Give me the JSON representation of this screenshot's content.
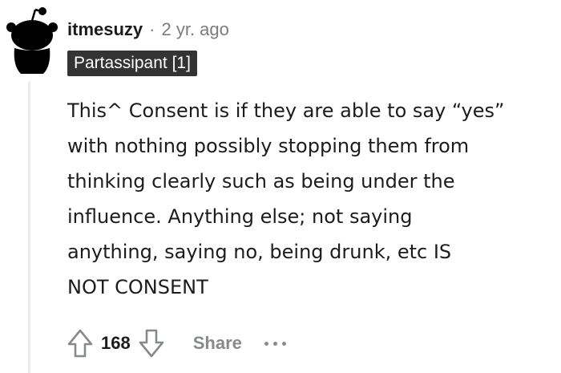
{
  "comment": {
    "username": "itmesuzy",
    "separator": "·",
    "timestamp": "2 yr. ago",
    "flair": "Partassipant [1]",
    "avatar_icon": "snoo-avatar-icon",
    "body_lines": [
      "This^ Consent is if they are able to say “yes”",
      "with nothing possibly stopping them from",
      "thinking clearly such as being under the",
      "influence. Anything else; not saying",
      "anything, saying no, being drunk, etc IS",
      "NOT CONSENT"
    ]
  },
  "actions": {
    "upvote_icon": "upvote-arrow-icon",
    "score": "168",
    "downvote_icon": "downvote-arrow-icon",
    "share_label": "Share",
    "more_icon": "more-options-icon"
  },
  "colors": {
    "text": "#1c1c1c",
    "muted": "#7c7c7c",
    "flair_bg": "#333333",
    "flair_text": "#ffffff",
    "action_gray": "#878a8c",
    "thread_line": "#e9ebed"
  }
}
